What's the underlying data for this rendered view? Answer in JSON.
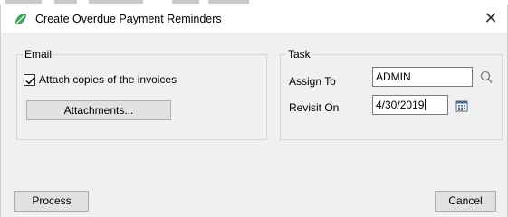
{
  "window": {
    "title": "Create Overdue Payment Reminders",
    "close_symbol": "✕"
  },
  "email_group": {
    "label": "Email",
    "attach_copies": {
      "label": "Attach copies of the invoices",
      "checked": true
    },
    "attachments_button": "Attachments..."
  },
  "task_group": {
    "label": "Task",
    "assign_to": {
      "label": "Assign To",
      "value": "ADMIN"
    },
    "revisit_on": {
      "label": "Revisit On",
      "value": "4/30/2019"
    }
  },
  "footer": {
    "process_button": "Process",
    "cancel_button": "Cancel"
  },
  "icons": {
    "app": "leaf-icon",
    "search": "magnifier-icon",
    "calendar": "calendar-icon"
  },
  "colors": {
    "app_icon": "#3aa655",
    "window_bg": "#f0f0f0",
    "button_bg": "#e1e1e1"
  }
}
